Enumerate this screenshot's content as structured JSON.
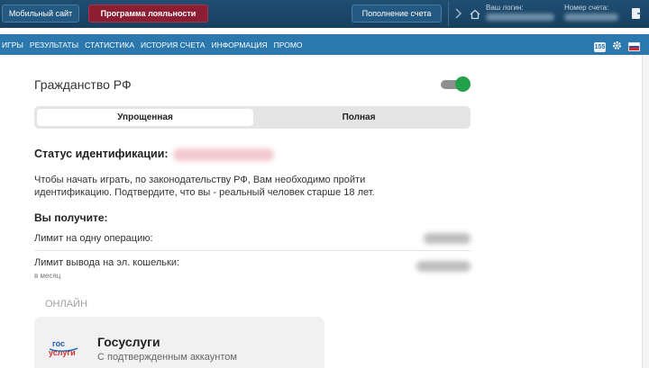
{
  "topbar": {
    "mobile_site": "Мобильный сайт",
    "loyalty_program": "Программа лояльности",
    "top_up": "Пополнение счета",
    "login_label": "Ваш логин:",
    "account_label": "Номер счета:"
  },
  "nav": {
    "items": [
      "ИГРЫ",
      "РЕЗУЛЬТАТЫ",
      "СТАТИСТИКА",
      "ИСТОРИЯ СЧЕТА",
      "ИНФОРМАЦИЯ",
      "ПРОМО"
    ],
    "badge": "155"
  },
  "main": {
    "heading": "Гражданство РФ",
    "toggle_on": true,
    "segments": [
      "Упрощенная",
      "Полная"
    ],
    "status_label": "Статус идентификации:",
    "description": "Чтобы начать играть, по законодательству РФ, Вам необходимо пройти идентификацию. Подтвердите, что вы - реальный человек старше 18 лет.",
    "you_get": "Вы получите:",
    "limit_operation": "Лимит на одну операцию:",
    "limit_withdraw": "Лимит вывода на эл. кошельки:",
    "per_month": "в месяц",
    "online": "Онлайн",
    "gos_title": "Госуслуги",
    "gos_subtitle": "С подтвержденным аккаунтом",
    "gos_logo_top": "гос",
    "gos_logo_bottom": "услуги"
  },
  "colors": {
    "topbar": "#1f4e72",
    "nav": "#2a78ad",
    "loyalty": "#8c1d33",
    "toggle": "#23a14a"
  }
}
